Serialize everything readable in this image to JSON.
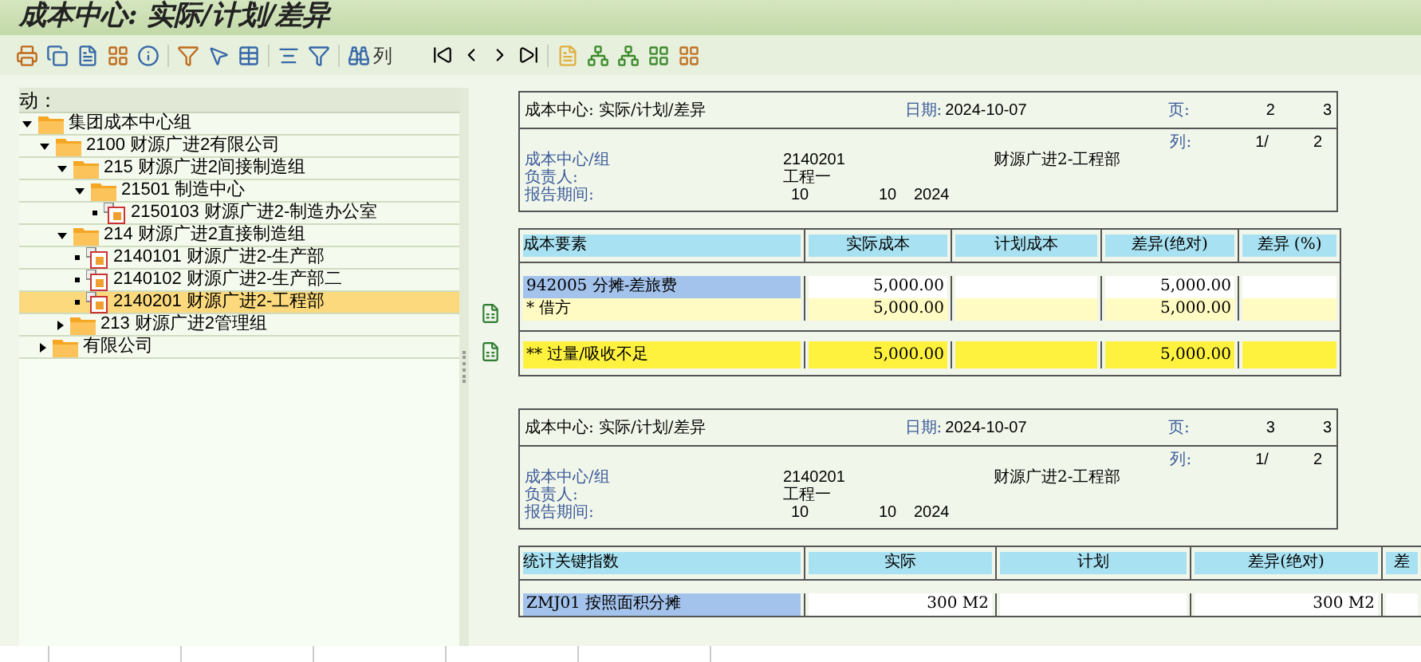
{
  "window": {
    "title": "成本中心: 实际/计划/差异"
  },
  "toolbar": {
    "column_button": "列"
  },
  "tree": {
    "header": "动：",
    "items": [
      {
        "label": "集团成本中心组",
        "kind": "folder",
        "expanded": true,
        "selected": false,
        "children": [
          {
            "label": "2100 财源广进2有限公司",
            "kind": "folder",
            "expanded": true,
            "selected": false,
            "children": [
              {
                "label": "215 财源广进2间接制造组",
                "kind": "folder",
                "expanded": true,
                "selected": false,
                "children": [
                  {
                    "label": "21501 制造中心",
                    "kind": "folder",
                    "expanded": true,
                    "selected": false,
                    "children": [
                      {
                        "label": "2150103 财源广进2-制造办公室",
                        "kind": "cost_center",
                        "selected": false
                      }
                    ]
                  }
                ]
              },
              {
                "label": "214 财源广进2直接制造组",
                "kind": "folder",
                "expanded": true,
                "selected": false,
                "children": [
                  {
                    "label": "2140101 财源广进2-生产部",
                    "kind": "cost_center",
                    "selected": false
                  },
                  {
                    "label": "2140102 财源广进2-生产部二",
                    "kind": "cost_center",
                    "selected": false
                  },
                  {
                    "label": "2140201 财源广进2-工程部",
                    "kind": "cost_center",
                    "selected": true
                  }
                ]
              },
              {
                "label": "213 财源广进2管理组",
                "kind": "folder",
                "expanded": false,
                "selected": false
              }
            ]
          },
          {
            "label": "有限公司",
            "kind": "folder",
            "expanded": false,
            "selected": false
          }
        ]
      }
    ]
  },
  "pages": [
    {
      "title": "成本中心: 实际/计划/差异",
      "date_label": "日期:",
      "date": "2024-10-07",
      "page_label": "页:",
      "page_no": "2",
      "page_total": "3",
      "col_label": "列:",
      "col_no": "1/",
      "col_total": "2",
      "cost_center_label": "成本中心/组",
      "cost_center": "2140201",
      "cost_center_name": "财源广进2-工程部",
      "owner_label": "负责人:",
      "owner": "工程一",
      "period_label": "报告期间:",
      "period_from": "10",
      "period_to": "10",
      "year": "2024",
      "table": {
        "kind": "cost",
        "columns": [
          "成本要素",
          "实际成本",
          "计划成本",
          "差异(绝对)",
          "差异 (%)"
        ],
        "rows": [
          {
            "kind": "item",
            "cells": [
              "942005  分摊-差旅费",
              "5,000.00",
              "",
              "5,000.00",
              ""
            ]
          },
          {
            "kind": "subtotal",
            "cells": [
              "*  借方",
              "5,000.00",
              "",
              "5,000.00",
              ""
            ]
          },
          {
            "kind": "total",
            "cells": [
              "** 过量/吸收不足",
              "5,000.00",
              "",
              "5,000.00",
              ""
            ]
          }
        ]
      }
    },
    {
      "title": "成本中心: 实际/计划/差异",
      "date_label": "日期:",
      "date": "2024-10-07",
      "page_label": "页:",
      "page_no": "3",
      "page_total": "3",
      "col_label": "列:",
      "col_no": "1/",
      "col_total": "2",
      "cost_center_label": "成本中心/组",
      "cost_center": "2140201",
      "cost_center_name": "财源广进2-工程部",
      "owner_label": "负责人:",
      "owner": "工程一",
      "period_label": "报告期间:",
      "period_from": "10",
      "period_to": "10",
      "year": "2024",
      "table": {
        "kind": "statistic",
        "columns": [
          "统计关键指数",
          "实际",
          "计划",
          "差异(绝对)",
          "差"
        ],
        "rows": [
          {
            "kind": "item",
            "cells": [
              "ZMJ01   按照面积分摊",
              "300   M2",
              "",
              "300   M2",
              ""
            ]
          }
        ]
      }
    }
  ]
}
